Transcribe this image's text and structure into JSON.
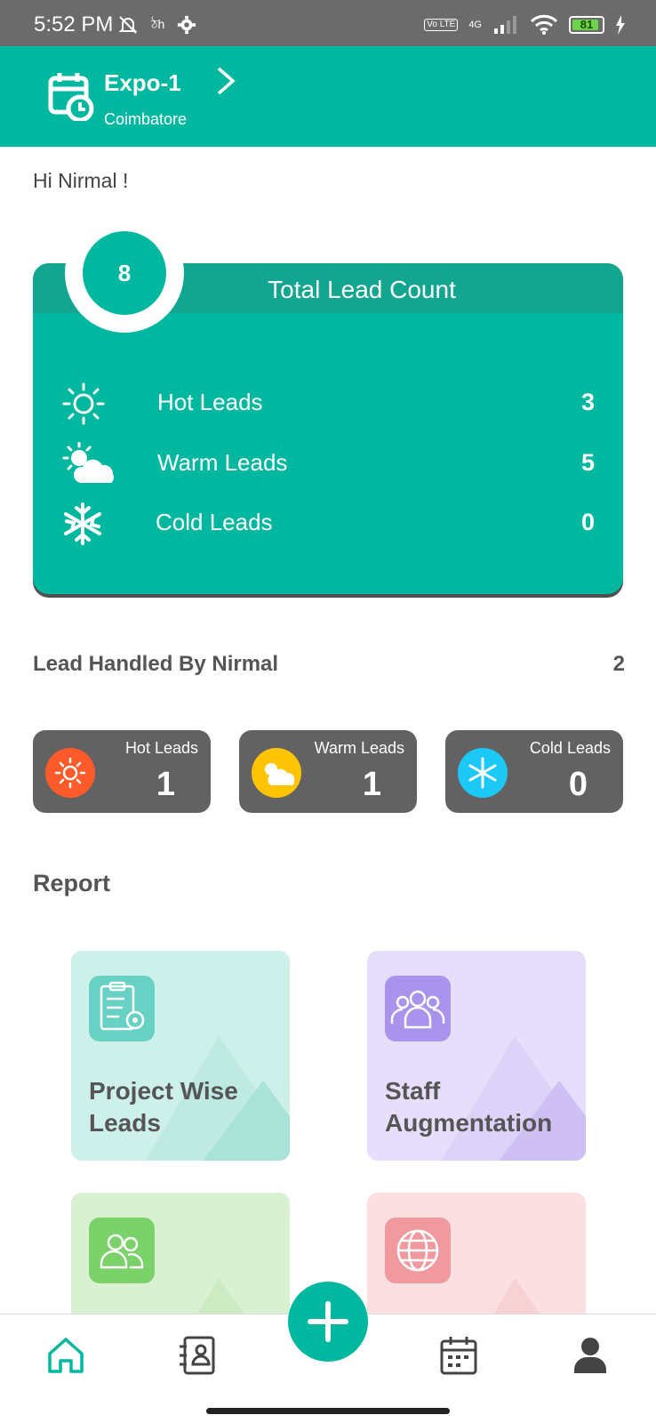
{
  "status_bar": {
    "time": "5:52 PM",
    "network": "4G",
    "volte": "Vo LTE",
    "battery": "81"
  },
  "header": {
    "title": "Expo-1",
    "subtitle": "Coimbatore"
  },
  "greeting": "Hi Nirmal !",
  "total_card": {
    "title": "Total Lead Count",
    "total": "8",
    "rows": [
      {
        "label": "Hot Leads",
        "value": "3",
        "icon": "sun-icon"
      },
      {
        "label": "Warm Leads",
        "value": "5",
        "icon": "sun-cloud-icon"
      },
      {
        "label": "Cold Leads",
        "value": "0",
        "icon": "snowflake-icon"
      }
    ]
  },
  "handled": {
    "title": "Lead Handled By Nirmal",
    "count": "2",
    "cards": [
      {
        "label": "Hot Leads",
        "value": "1",
        "color": "#ff5a2a"
      },
      {
        "label": "Warm Leads",
        "value": "1",
        "color": "#ffc400"
      },
      {
        "label": "Cold Leads",
        "value": "0",
        "color": "#1cc8f5"
      }
    ]
  },
  "report": {
    "title": "Report",
    "tiles": [
      {
        "label": "Project Wise Leads",
        "bg": "#cdf1ea",
        "icon_bg": "#67d2c3",
        "icon": "clipboard-gear-icon"
      },
      {
        "label": "Staff Augmentation",
        "bg": "#e6defb",
        "icon_bg": "#a993ec",
        "icon": "team-icon"
      },
      {
        "label": "",
        "bg": "#d9f1d1",
        "icon_bg": "#7bd16a",
        "icon": "users-icon"
      },
      {
        "label": "",
        "bg": "#fbdfe1",
        "icon_bg": "#f09aa0",
        "icon": "globe-icon"
      }
    ]
  },
  "colors": {
    "primary": "#00b8a0",
    "header_band": "#12a58f",
    "card_dark": "#626262"
  }
}
